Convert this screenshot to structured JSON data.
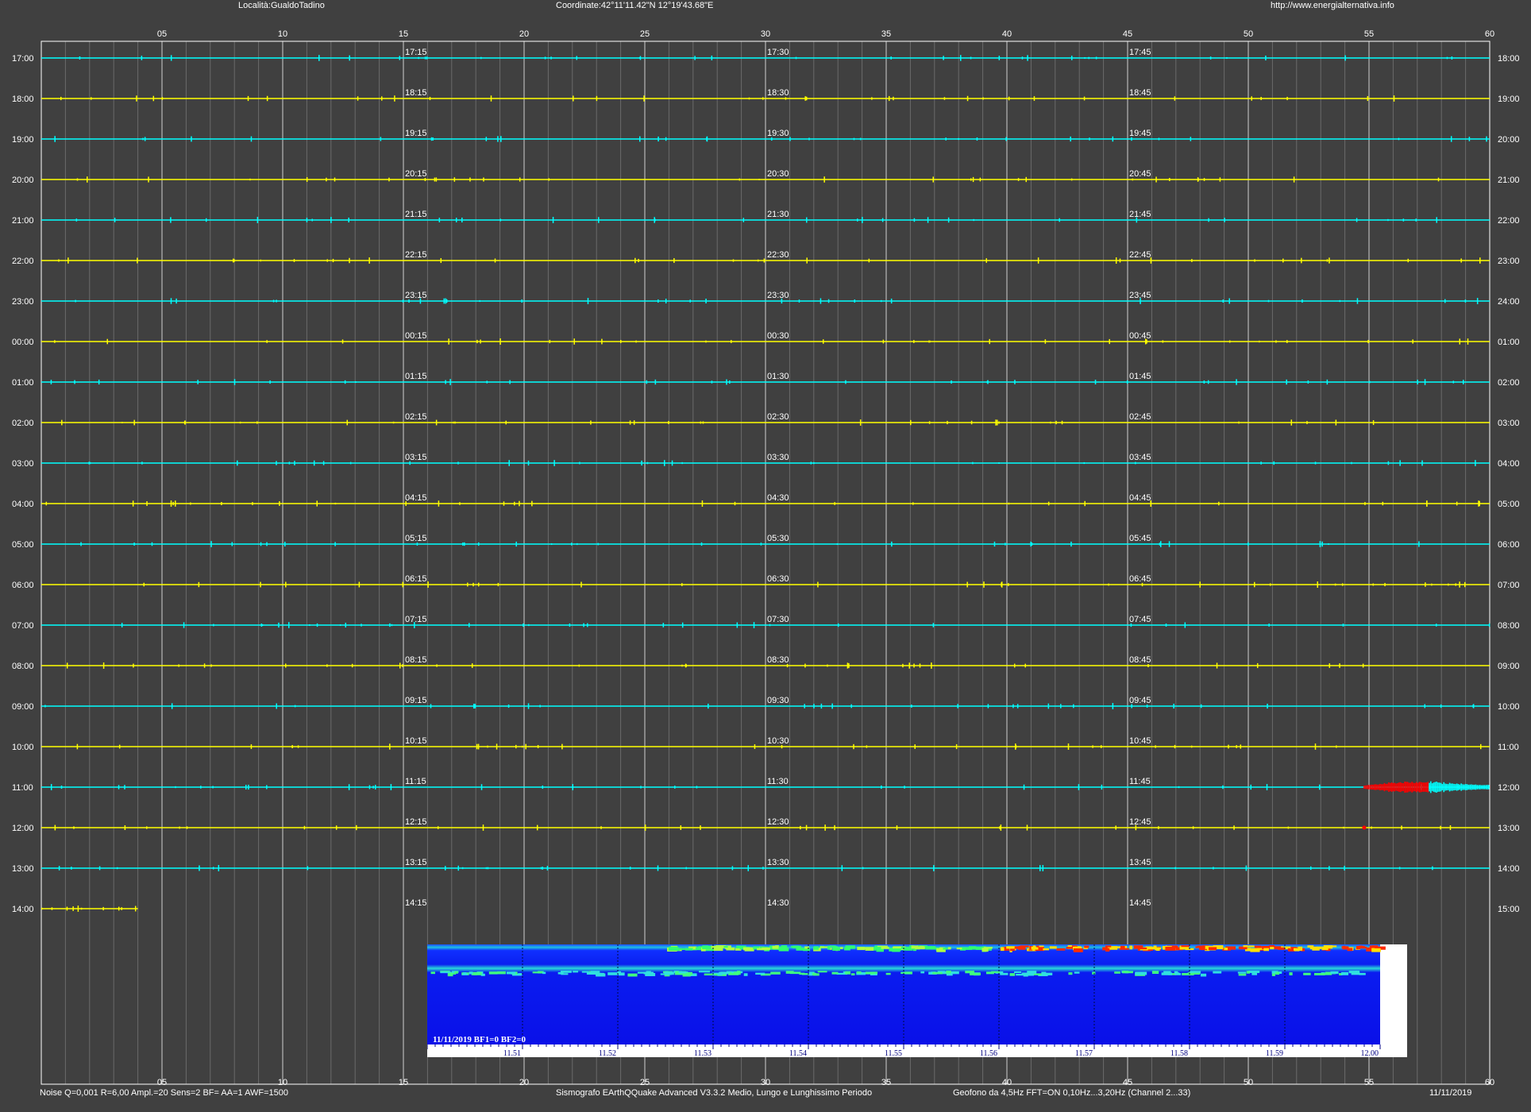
{
  "header": {
    "location": "Località:GualdoTadino",
    "coordinates": "Coordinate:42°11'11.42\"N  12°19'43.68\"E",
    "url": "http://www.energialternativa.info"
  },
  "footer": {
    "settings": "Noise Q=0,001 R=6,00 Ampl.=20 Sens=2 BF= AA=1 AWF=1500",
    "software": "Sismografo  EArthQQuake Advanced V3.3.2  Medio, Lungo e Lunghissimo Periodo",
    "geophone": "Geofono da 4,5Hz FFT=ON 0,10Hz...3,20Hz      (Channel 2...33)",
    "date": "11/11/2019"
  },
  "colors": {
    "background": "#404040",
    "frame": "#ffffff",
    "trace_odd": "#00ffff",
    "trace_even": "#ffff00",
    "event": "#ff0000"
  },
  "chart_data": [
    {
      "type": "line",
      "title": "",
      "x_axis": {
        "min": 0,
        "max": 60,
        "unit": "minutes",
        "tick_labels": [
          "05",
          "10",
          "15",
          "20",
          "25",
          "30",
          "35",
          "40",
          "45",
          "50",
          "55",
          "60"
        ],
        "major_every": 5,
        "minor_every": 1
      },
      "rows": [
        {
          "left": "17:00",
          "right": "18:00",
          "marks": [
            "17:15",
            "17:30",
            "17:45"
          ],
          "color": "cyan"
        },
        {
          "left": "18:00",
          "right": "19:00",
          "marks": [
            "18:15",
            "18:30",
            "18:45"
          ],
          "color": "yellow"
        },
        {
          "left": "19:00",
          "right": "20:00",
          "marks": [
            "19:15",
            "19:30",
            "19:45"
          ],
          "color": "cyan"
        },
        {
          "left": "20:00",
          "right": "21:00",
          "marks": [
            "20:15",
            "20:30",
            "20:45"
          ],
          "color": "yellow"
        },
        {
          "left": "21:00",
          "right": "22:00",
          "marks": [
            "21:15",
            "21:30",
            "21:45"
          ],
          "color": "cyan"
        },
        {
          "left": "22:00",
          "right": "23:00",
          "marks": [
            "22:15",
            "22:30",
            "22:45"
          ],
          "color": "yellow"
        },
        {
          "left": "23:00",
          "right": "24:00",
          "marks": [
            "23:15",
            "23:30",
            "23:45"
          ],
          "color": "cyan"
        },
        {
          "left": "00:00",
          "right": "01:00",
          "marks": [
            "00:15",
            "00:30",
            "00:45"
          ],
          "color": "yellow"
        },
        {
          "left": "01:00",
          "right": "02:00",
          "marks": [
            "01:15",
            "01:30",
            "01:45"
          ],
          "color": "cyan"
        },
        {
          "left": "02:00",
          "right": "03:00",
          "marks": [
            "02:15",
            "02:30",
            "02:45"
          ],
          "color": "yellow"
        },
        {
          "left": "03:00",
          "right": "04:00",
          "marks": [
            "03:15",
            "03:30",
            "03:45"
          ],
          "color": "cyan"
        },
        {
          "left": "04:00",
          "right": "05:00",
          "marks": [
            "04:15",
            "04:30",
            "04:45"
          ],
          "color": "yellow"
        },
        {
          "left": "05:00",
          "right": "06:00",
          "marks": [
            "05:15",
            "05:30",
            "05:45"
          ],
          "color": "cyan"
        },
        {
          "left": "06:00",
          "right": "07:00",
          "marks": [
            "06:15",
            "06:30",
            "06:45"
          ],
          "color": "yellow"
        },
        {
          "left": "07:00",
          "right": "08:00",
          "marks": [
            "07:15",
            "07:30",
            "07:45"
          ],
          "color": "cyan"
        },
        {
          "left": "08:00",
          "right": "09:00",
          "marks": [
            "08:15",
            "08:30",
            "08:45"
          ],
          "color": "yellow"
        },
        {
          "left": "09:00",
          "right": "10:00",
          "marks": [
            "09:15",
            "09:30",
            "09:45"
          ],
          "color": "cyan"
        },
        {
          "left": "10:00",
          "right": "11:00",
          "marks": [
            "10:15",
            "10:30",
            "10:45"
          ],
          "color": "yellow"
        },
        {
          "left": "11:00",
          "right": "12:00",
          "marks": [
            "11:15",
            "11:30",
            "11:45"
          ],
          "color": "cyan"
        },
        {
          "left": "12:00",
          "right": "13:00",
          "marks": [
            "12:15",
            "12:30",
            "12:45"
          ],
          "color": "yellow"
        },
        {
          "left": "13:00",
          "right": "14:00",
          "marks": [
            "13:15",
            "13:30",
            "13:45"
          ],
          "color": "cyan"
        },
        {
          "left": "14:00",
          "right": "15:00",
          "marks": [
            "14:15",
            "14:30",
            "14:45"
          ],
          "color": "yellow"
        }
      ],
      "trace_end_minutes_last_row": 4,
      "event": {
        "row": "11:00",
        "start_minute": 54.8,
        "red_end_minute": 57.5,
        "end_minute": 60
      }
    },
    {
      "type": "heatmap",
      "title": "11/11/2019 BF1=0 BF2=0",
      "x_axis": {
        "tick_labels": [
          "11.51",
          "11.52",
          "11.53",
          "11.54",
          "11.55",
          "11.56",
          "11.57",
          "11.58",
          "11.59",
          "12.00"
        ]
      },
      "y_range_hz": [
        0.1,
        3.2
      ],
      "colormap": "blue-cyan-green-yellow-red",
      "energy_bands": [
        {
          "name": "top band",
          "intensity_trend": "rises to red after 11.56"
        },
        {
          "name": "secondary band",
          "intensity": "green/cyan constant"
        }
      ]
    }
  ]
}
